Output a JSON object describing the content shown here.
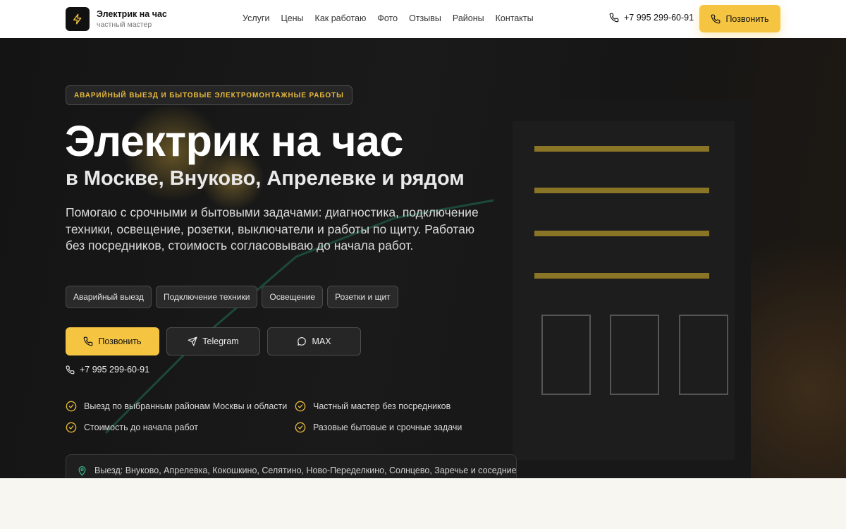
{
  "header": {
    "brand_name": "Электрик на час",
    "brand_sub": "частный мастер",
    "nav": [
      "Услуги",
      "Цены",
      "Как работаю",
      "Фото",
      "Отзывы",
      "Районы",
      "Контакты"
    ],
    "phone": "+7 995 299-60-91",
    "call_label": "Позвонить"
  },
  "hero": {
    "badge": "АВАРИЙНЫЙ ВЫЕЗД И БЫТОВЫЕ ЭЛЕКТРОМОНТАЖНЫЕ РАБОТЫ",
    "title": "Электрик на час",
    "subtitle": "в Москве, Внуково, Апрелевке и рядом",
    "lead": "Помогаю с срочными и бытовыми задачами: диагностика, подключение техники, освещение, розетки, выключатели и работы по щиту. Работаю без посредников, стоимость согласовываю до начала работ.",
    "tags": [
      "Аварийный выезд",
      "Подключение техники",
      "Освещение",
      "Розетки и щит"
    ],
    "buttons": {
      "call": "Позвонить",
      "telegram": "Telegram",
      "max": "MAX"
    },
    "phone": "+7 995 299-60-91",
    "features": [
      "Выезд по выбранным районам Москвы и области",
      "Частный мастер без посредников",
      "Стоимость до начала работ",
      "Разовые бытовые и срочные задачи"
    ],
    "areas": "Выезд: Внуково, Апрелевка, Кокошкино, Селятино, Ново-Переделкино, Солнцево, Заречье и соседние"
  },
  "colors": {
    "accent": "#f5c542",
    "hero_bg": "#141414",
    "page_bg": "#f8f6f1"
  },
  "icons": {
    "logo": "lightning-icon",
    "phone": "phone-icon",
    "telegram": "send-icon",
    "max": "chat-bubble-icon",
    "feature": "check-circle-icon",
    "areas": "map-pin-icon"
  }
}
